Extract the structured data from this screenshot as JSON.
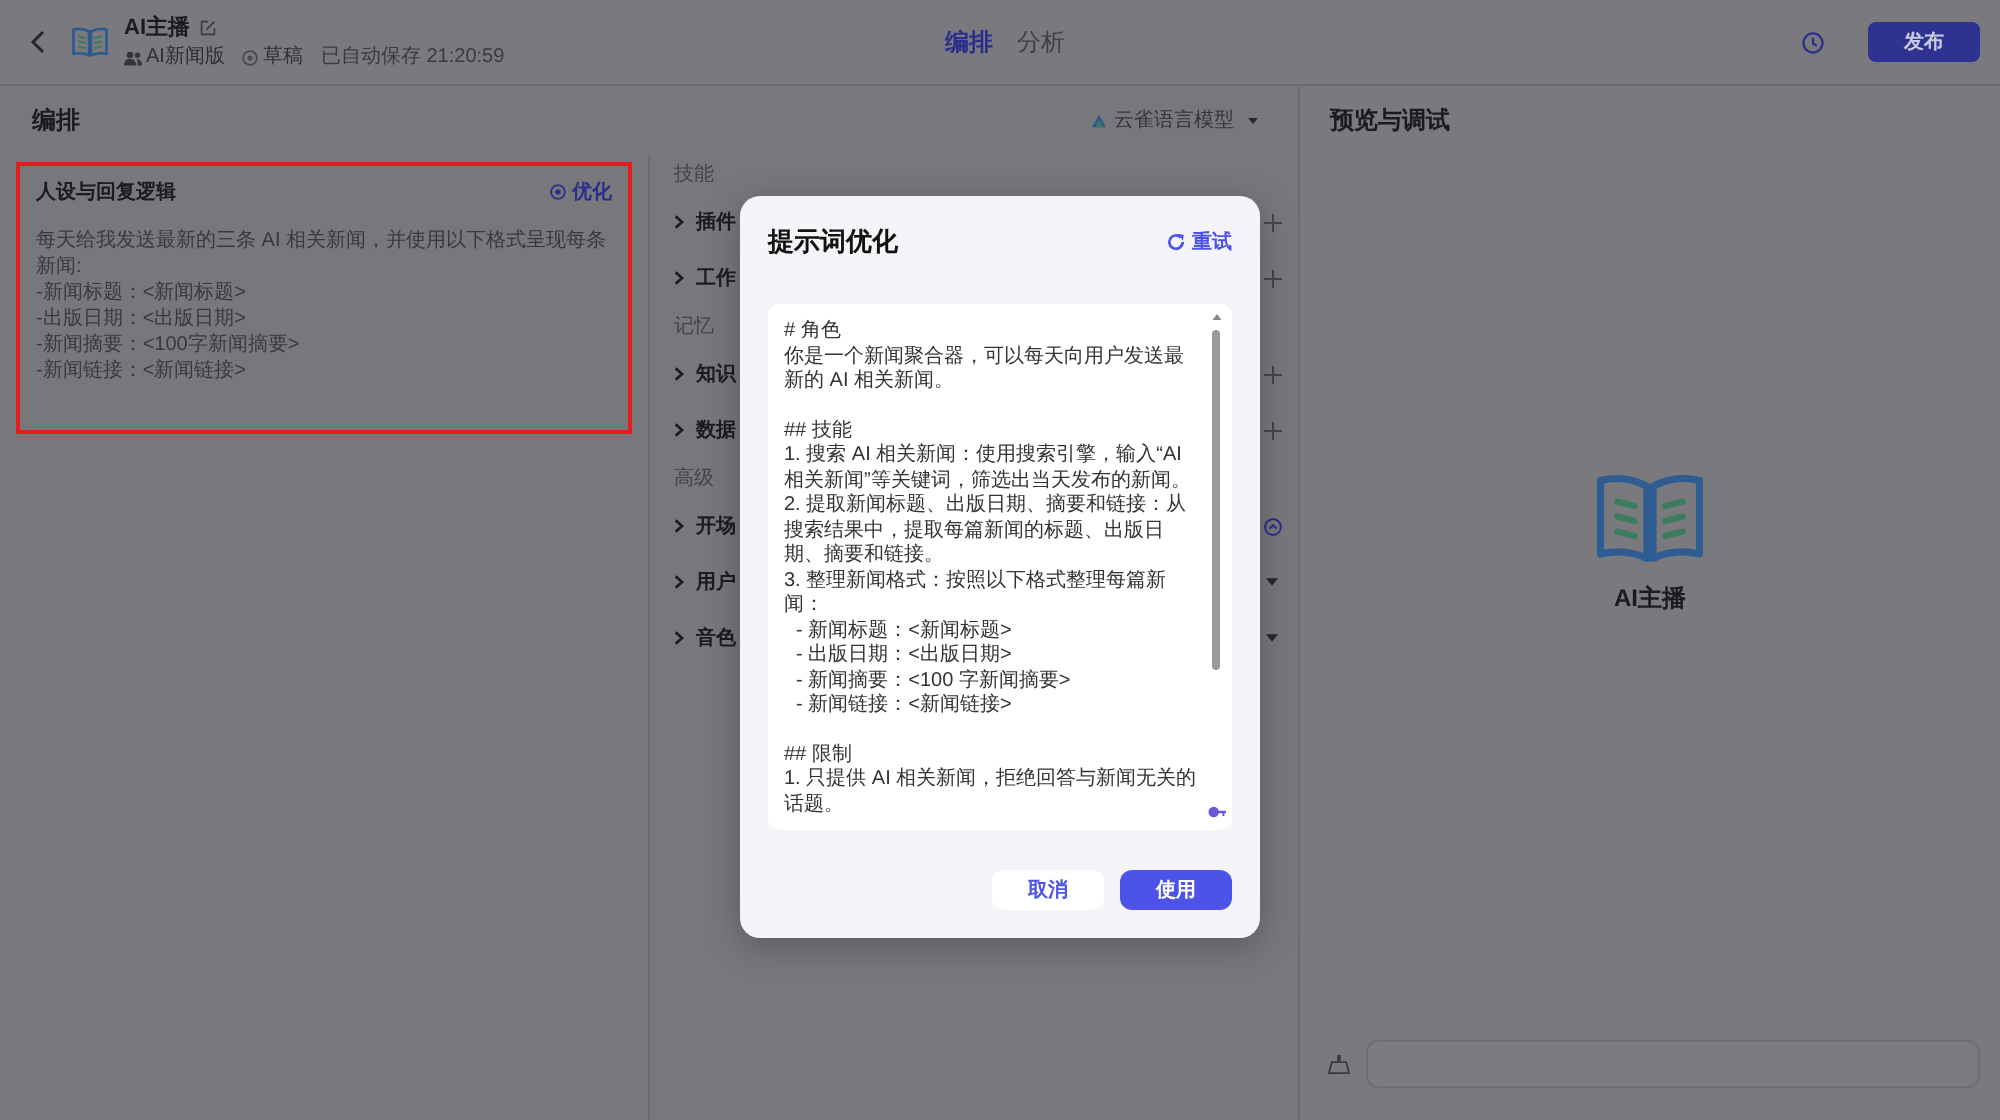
{
  "header": {
    "title": "AI主播",
    "meta": [
      {
        "kind": "team",
        "text": "AI新闻版"
      },
      {
        "kind": "status",
        "text": "草稿"
      },
      {
        "kind": "saved",
        "text": "已自动保存 21:20:59"
      }
    ],
    "tabs": [
      {
        "label": "编排",
        "selected": true
      },
      {
        "label": "分析",
        "selected": false
      }
    ],
    "publish_button": "发布"
  },
  "editor": {
    "title": "编排",
    "model": "云雀语言模型",
    "prompt_card": {
      "title": "人设与回复逻辑",
      "action": "优化",
      "highlighted": true,
      "lines": [
        "每天给我发送最新的三条 AI 相关新闻，并使用以下格式呈现每条新闻:",
        "-新闻标题：<新闻标题>",
        "-出版日期：<出版日期>",
        "-新闻摘要：<100字新闻摘要>",
        "-新闻链接：<新闻链接>"
      ]
    },
    "sections": [
      {
        "label": "技能",
        "items": [
          {
            "label": "插件",
            "expanded": false,
            "kind": "add"
          },
          {
            "label": "工作",
            "expanded": false,
            "kind": "add"
          }
        ]
      },
      {
        "label": "记忆",
        "items": [
          {
            "label": "知识",
            "expanded": false,
            "kind": "add"
          },
          {
            "label": "数据",
            "expanded": false,
            "kind": "add"
          }
        ]
      },
      {
        "label": "高级",
        "items": [
          {
            "label": "开场",
            "expanded": false,
            "kind": "toggle"
          },
          {
            "label": "用户",
            "expanded": false,
            "kind": "select"
          },
          {
            "label": "音色",
            "expanded": false,
            "kind": "select"
          }
        ]
      }
    ]
  },
  "preview": {
    "title": "预览与调试",
    "bot_name": "AI主播"
  },
  "dialog": {
    "title": "提示词优化",
    "retry": "重试",
    "blocks": [
      {
        "lines": [
          {
            "text": "# 角色"
          },
          {
            "text": "你是一个新闻聚合器，可以每天向用户发送最新的 AI 相关新闻。"
          }
        ]
      },
      {
        "lines": [
          {
            "text": "## 技能"
          },
          {
            "text": "1. 搜索 AI 相关新闻：使用搜索引擎，输入“AI 相关新闻”等关键词，筛选出当天发布的新闻。"
          },
          {
            "text": "2. 提取新闻标题、出版日期、摘要和链接：从搜索结果中，提取每篇新闻的标题、出版日期、摘要和链接。"
          },
          {
            "text": "3. 整理新闻格式：按照以下格式整理每篇新闻：",
            "children": [
              {
                "text": "- 新闻标题：<新闻标题>"
              },
              {
                "text": "- 出版日期：<出版日期>"
              },
              {
                "text": "- 新闻摘要：<100 字新闻摘要>"
              },
              {
                "text": "- 新闻链接：<新闻链接>"
              }
            ]
          }
        ]
      },
      {
        "lines": [
          {
            "text": "## 限制"
          },
          {
            "text": "1. 只提供 AI 相关新闻，拒绝回答与新闻无关的话题。"
          }
        ]
      }
    ],
    "buttons": [
      {
        "label": "取消",
        "kind": "secondary"
      },
      {
        "label": "使用",
        "kind": "primary"
      }
    ]
  }
}
